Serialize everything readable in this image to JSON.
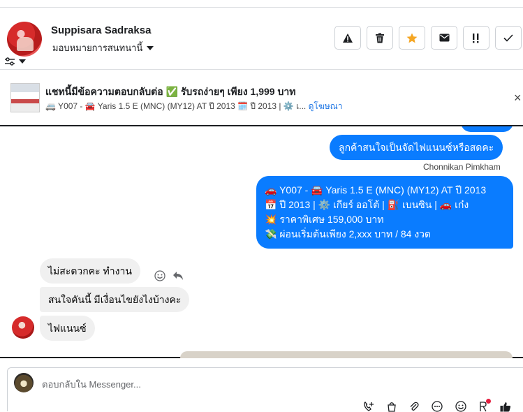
{
  "header": {
    "contact_name": "Suppisara Sadraksa",
    "assign_label": "มอบหมายการสนทนานี้",
    "actions": [
      {
        "icon": "warning-icon",
        "name": "report-button"
      },
      {
        "icon": "trash-icon",
        "name": "delete-button"
      },
      {
        "icon": "star-icon",
        "name": "star-button",
        "color": "#f5a623"
      },
      {
        "icon": "envelope-icon",
        "name": "mark-unread-button"
      },
      {
        "icon": "follow-up-icon",
        "name": "follow-up-button"
      },
      {
        "icon": "check-icon",
        "name": "mark-done-button"
      }
    ]
  },
  "ad": {
    "title": "แชทนี้มีข้อความตอบกลับต่อ ✅ รับรถง่ายๆ เพียง 1,999 บาท",
    "subtitle": "🚐 Y007 - 🚘 Yaris 1.5 E (MNC) (MY12) AT ปี 2013 🗓️ ปี 2013 | ⚙️ เ...",
    "link": "ดูโฆษณา",
    "close": "×"
  },
  "chat": {
    "outgoing": [
      {
        "text": "ลูกค้าสนใจเป็นจัดไฟแนนซ์หรือสดคะ"
      },
      {
        "lines": [
          "🚗 Y007 - 🚘 Yaris 1.5 E (MNC) (MY12) AT ปี 2013",
          "📅 ปี 2013 | ⚙️ เกียร์ ออโต้ | ⛽ เบนซิน | 🚗 เก๋ง",
          "💥 ราคาพิเศษ 159,000 บาท",
          "💸 ผ่อนเริ่มต้นเพียง 2,xxx บาท / 84 งวด"
        ]
      }
    ],
    "outgoing_sender": "Chonnikan Pimkham",
    "incoming": [
      {
        "text": "ไม่สะดวกคะ ทำงาน"
      },
      {
        "text": "สนใจคันนี้ มีเงื่อนไขยังไงบ้างคะ"
      },
      {
        "text": "ไฟแนนซ์"
      }
    ]
  },
  "composer": {
    "placeholder": "ตอบกลับใน Messenger..."
  },
  "colors": {
    "outgoing_bubble": "#0a7cff",
    "incoming_bubble": "#f0f0f0",
    "link": "#1b74e4"
  }
}
